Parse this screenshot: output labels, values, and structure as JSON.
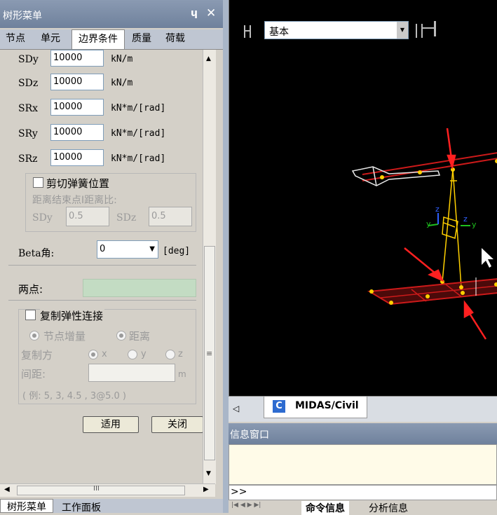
{
  "panel": {
    "title": "树形菜单",
    "pin_label": "ɥ",
    "close_label": "✕",
    "tabs": [
      "节点",
      "单元",
      "边界条件",
      "质量",
      "荷载"
    ],
    "active_tab": 2
  },
  "springs": [
    {
      "label": "SDy",
      "value": "10000",
      "unit": "kN/m"
    },
    {
      "label": "SDz",
      "value": "10000",
      "unit": "kN/m"
    },
    {
      "label": "SRx",
      "value": "10000",
      "unit": "kN*m/[rad]"
    },
    {
      "label": "SRy",
      "value": "10000",
      "unit": "kN*m/[rad]"
    },
    {
      "label": "SRz",
      "value": "10000",
      "unit": "kN*m/[rad]"
    }
  ],
  "shear_spring": {
    "checkbox_label": "剪切弹簧位置",
    "ratio_label": "距离结束点I距离比:",
    "sdy_label": "SDy",
    "sdy_value": "0.5",
    "sdz_label": "SDz",
    "sdz_value": "0.5"
  },
  "beta": {
    "label": "Beta角:",
    "value": "0",
    "unit": "[deg]"
  },
  "two_points": {
    "label": "两点:"
  },
  "copy": {
    "checkbox_label": "复制弹性连接",
    "node_increment": "节点增量",
    "distance": "距离",
    "direction_label": "复制方",
    "dir_x": "x",
    "dir_y": "y",
    "dir_z": "z",
    "spacing_label": "间距:",
    "spacing_unit": "m",
    "example": "( 例: 5, 3, 4.5 , 3@5.0 )"
  },
  "buttons": {
    "apply": "适用",
    "close": "关闭"
  },
  "hscroll_grip": "III",
  "vscroll_grip": "≡",
  "bottom_tabs": [
    "树形菜单",
    "工作面板"
  ],
  "view": {
    "combo_value": "基本",
    "tab_label": "MIDAS/Civil"
  },
  "messages": {
    "title": "信息窗口",
    "prompt": ">>",
    "tabs": [
      "命令信息",
      "分析信息"
    ]
  },
  "colors": {
    "titlebar": "#7a8ba6",
    "arrow": "#ff2020",
    "beam_red": "#cc1a1a",
    "node_yellow": "#ffd000",
    "two_points_field": "#c3dcc3"
  }
}
